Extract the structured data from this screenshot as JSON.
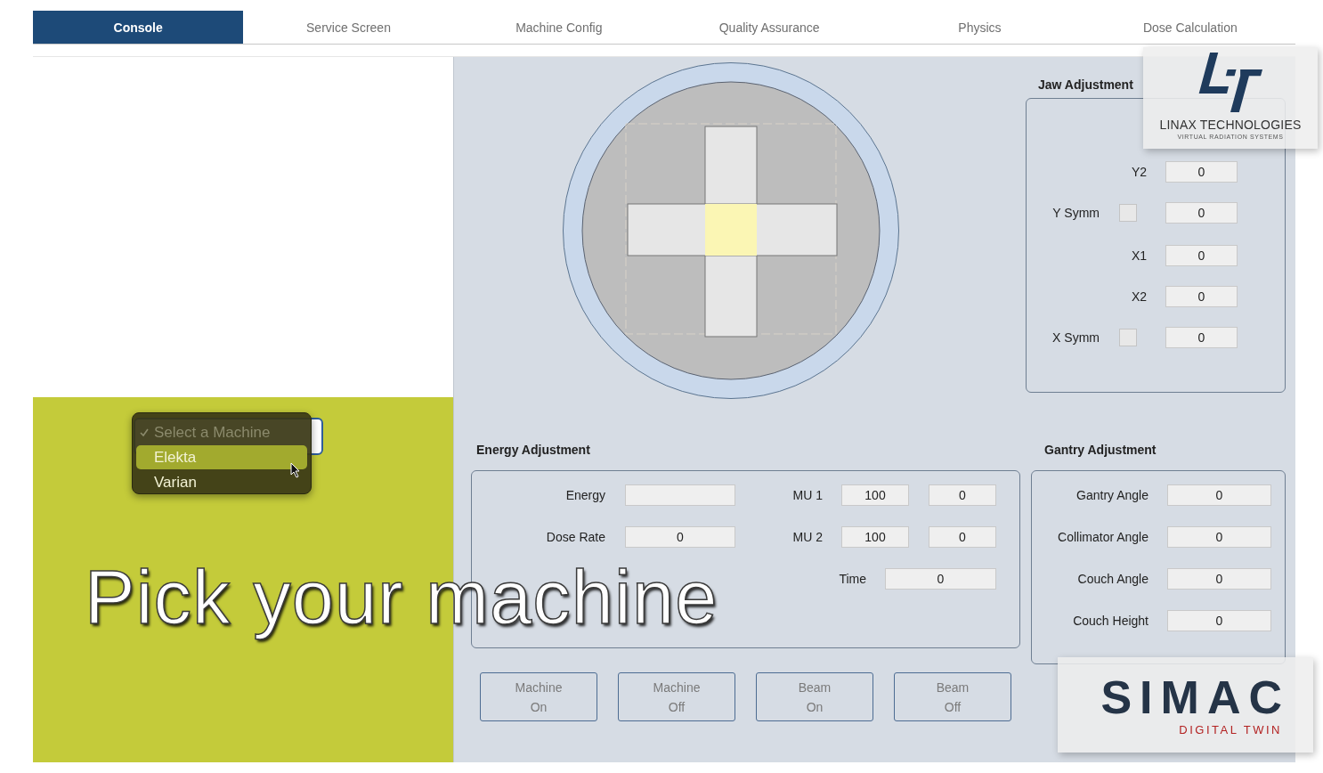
{
  "tabs": [
    {
      "label": "Console",
      "selected": true
    },
    {
      "label": "Service Screen",
      "selected": false
    },
    {
      "label": "Machine Config",
      "selected": false
    },
    {
      "label": "Quality Assurance",
      "selected": false
    },
    {
      "label": "Physics",
      "selected": false
    },
    {
      "label": "Dose Calculation",
      "selected": false
    }
  ],
  "machine_select": {
    "open": true,
    "options": [
      {
        "label": "Select a Machine",
        "checked": true,
        "disabled": true,
        "selected": false
      },
      {
        "label": "Elekta",
        "checked": false,
        "disabled": false,
        "selected": true
      },
      {
        "label": "Varian",
        "checked": false,
        "disabled": false,
        "selected": false
      }
    ]
  },
  "caption": "Pick your machine",
  "jaw_adjustment": {
    "title": "Jaw Adjustment",
    "rows": [
      {
        "kind": "field",
        "label": "Y2",
        "value": "0"
      },
      {
        "kind": "symm",
        "label": "Y Symm",
        "checked": false,
        "value": "0"
      },
      {
        "kind": "field",
        "label": "X1",
        "value": "0"
      },
      {
        "kind": "field",
        "label": "X2",
        "value": "0"
      },
      {
        "kind": "symm",
        "label": "X Symm",
        "checked": false,
        "value": "0"
      }
    ]
  },
  "energy_adjustment": {
    "title": "Energy Adjustment",
    "left_rows": [
      {
        "label": "Energy"
      },
      {
        "label": "Dose Rate",
        "value": "0"
      }
    ],
    "right_rows": [
      {
        "label": "MU 1",
        "values": [
          "100",
          "0"
        ]
      },
      {
        "label": "MU 2",
        "values": [
          "100",
          "0"
        ]
      },
      {
        "label": "Time",
        "values": [
          "0"
        ]
      }
    ]
  },
  "gantry_adjustment": {
    "title": "Gantry Adjustment",
    "rows": [
      {
        "label": "Gantry Angle",
        "value": "0"
      },
      {
        "label": "Collimator Angle",
        "value": "0"
      },
      {
        "label": "Couch Angle",
        "value": "0"
      },
      {
        "label": "Couch Height",
        "value": "0"
      }
    ]
  },
  "buttons": [
    {
      "lines": [
        "Machine",
        "On"
      ]
    },
    {
      "lines": [
        "Machine",
        "Off"
      ]
    },
    {
      "lines": [
        "Beam",
        "On"
      ]
    },
    {
      "lines": [
        "Beam",
        "Off"
      ]
    }
  ],
  "overlays": {
    "linax": {
      "name": "LINAX TECHNOLOGIES",
      "tagline": "VIRTUAL RADIATION SYSTEMS"
    },
    "simac": {
      "name": "SIMAC",
      "tagline": "DIGITAL TWIN"
    }
  }
}
